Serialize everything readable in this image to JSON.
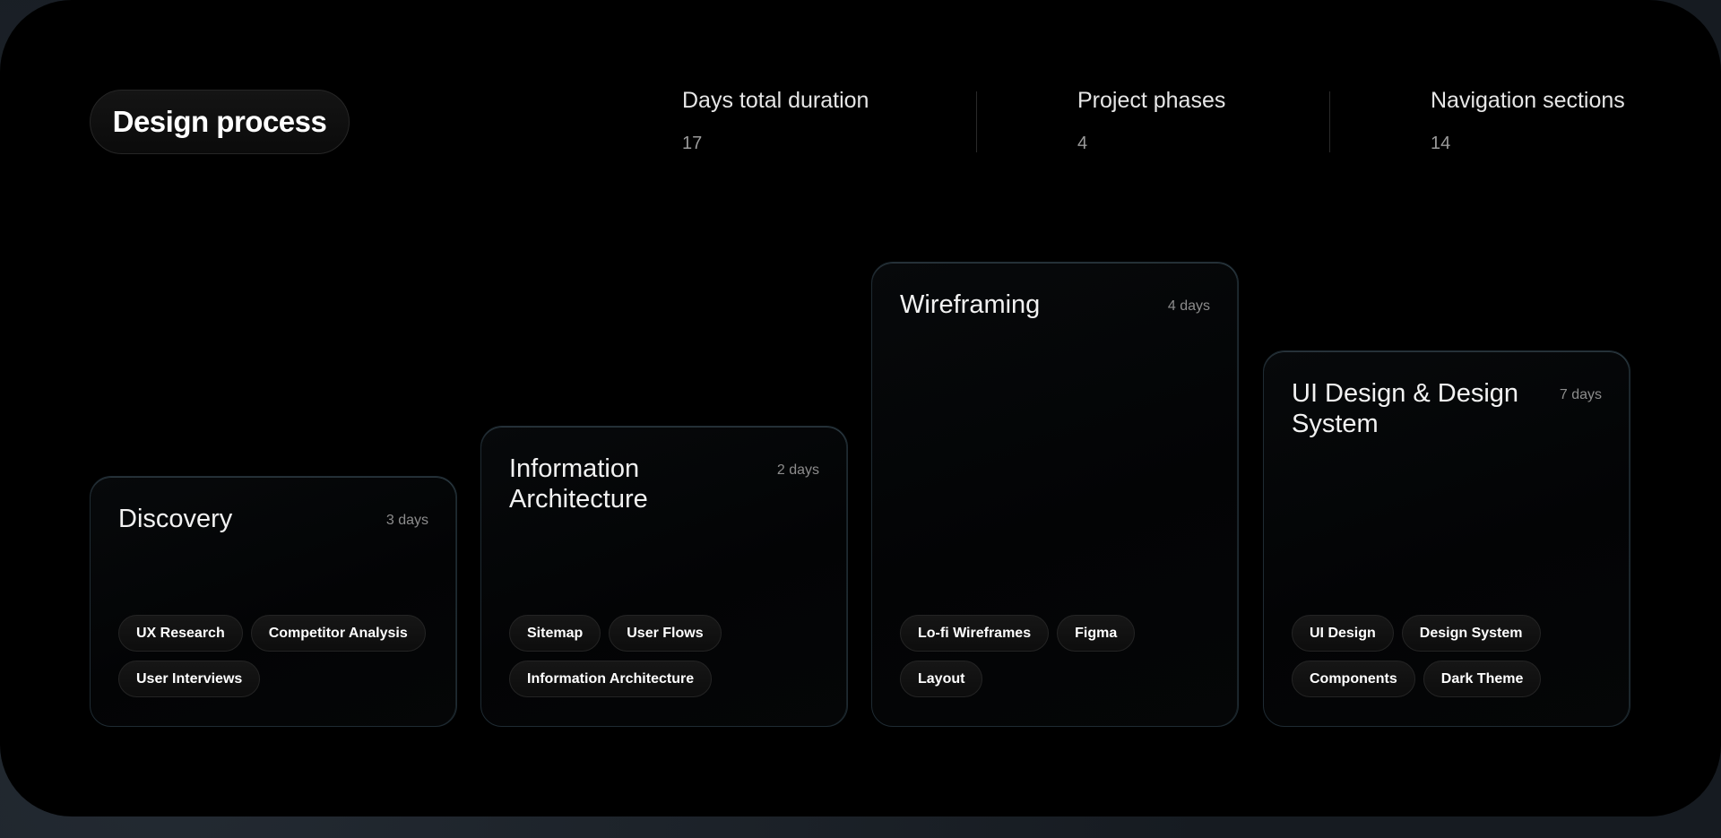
{
  "header": {
    "title": "Design process"
  },
  "stats": [
    {
      "label": "Days total duration",
      "value": "17"
    },
    {
      "label": "Project phases",
      "value": "4"
    },
    {
      "label": "Navigation sections",
      "value": "14"
    }
  ],
  "phases": [
    {
      "title": "Discovery",
      "duration": "3 days",
      "tags": [
        "UX Research",
        "Competitor Analysis",
        "User Interviews"
      ]
    },
    {
      "title": "Information Architecture",
      "duration": "2 days",
      "tags": [
        "Sitemap",
        "User Flows",
        "Information Architecture"
      ]
    },
    {
      "title": "Wireframing",
      "duration": "4 days",
      "tags": [
        "Lo-fi Wireframes",
        "Figma",
        "Layout"
      ]
    },
    {
      "title": "UI Design & Design System",
      "duration": "7 days",
      "tags": [
        "UI Design",
        "Design System",
        "Components",
        "Dark Theme"
      ]
    }
  ],
  "colors": {
    "background": "#000000",
    "card_border_accent": "#8fb8c8",
    "text_primary": "#ffffff",
    "text_muted": "#9a9a9a"
  }
}
